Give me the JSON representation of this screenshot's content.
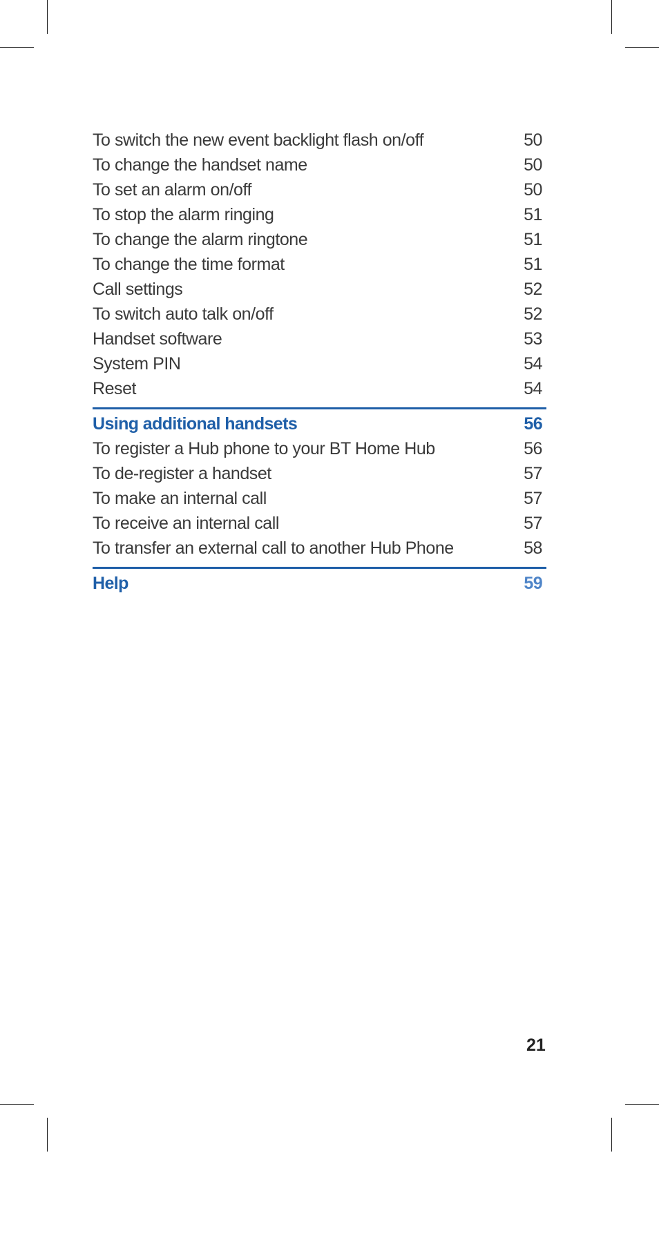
{
  "toc": {
    "group1": [
      {
        "label": "To switch the new event backlight flash on/off",
        "page": "50"
      },
      {
        "label": "To change the handset name",
        "page": "50"
      },
      {
        "label": "To set an alarm on/off",
        "page": "50"
      },
      {
        "label": "To stop the alarm ringing",
        "page": "51"
      },
      {
        "label": "To change the alarm ringtone",
        "page": "51"
      },
      {
        "label": "To change the time format",
        "page": "51"
      },
      {
        "label": "Call settings",
        "page": "52"
      },
      {
        "label": "To switch auto talk on/off",
        "page": "52"
      },
      {
        "label": "Handset software",
        "page": "53"
      },
      {
        "label": "System PIN",
        "page": "54"
      },
      {
        "label": "Reset",
        "page": "54"
      }
    ],
    "section_additional": {
      "label": "Using additional handsets",
      "page": "56"
    },
    "group2": [
      {
        "label": "To register a Hub phone to your BT Home Hub",
        "page": "56"
      },
      {
        "label": "To de-register a handset",
        "page": "57"
      },
      {
        "label": "To make an internal call",
        "page": "57"
      },
      {
        "label": "To receive an internal call",
        "page": "57"
      },
      {
        "label": "To transfer an external call to another Hub Phone",
        "page": "58"
      }
    ],
    "section_help": {
      "label": "Help",
      "page": "59"
    }
  },
  "page_number": "21",
  "colors": {
    "accent": "#1f5fa8",
    "accent_light": "#4f85c8",
    "text": "#3a3a3a"
  }
}
